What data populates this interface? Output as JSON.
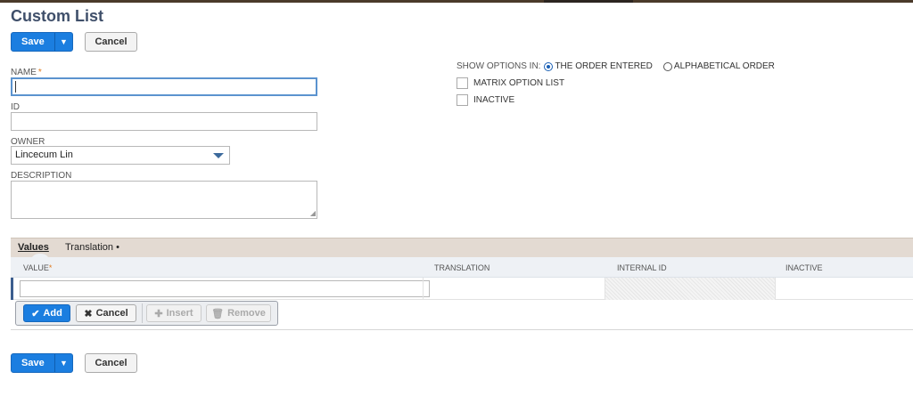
{
  "page": {
    "title": "Custom List"
  },
  "toolbar": {
    "save_label": "Save",
    "dropdown_glyph": "▼",
    "cancel_label": "Cancel"
  },
  "form": {
    "name_label": "NAME",
    "required_mark": "*",
    "name_value": "",
    "id_label": "ID",
    "id_value": "",
    "owner_label": "OWNER",
    "owner_value": "Lincecum Lin",
    "description_label": "DESCRIPTION",
    "description_value": ""
  },
  "options": {
    "show_label": "SHOW OPTIONS IN:",
    "order_entered": "THE ORDER ENTERED",
    "alphabetical": "ALPHABETICAL ORDER",
    "selected": "order_entered",
    "matrix_label": "MATRIX OPTION LIST",
    "matrix_checked": false,
    "inactive_label": "INACTIVE",
    "inactive_checked": false
  },
  "tabs": [
    {
      "label": "Values",
      "active": true
    },
    {
      "label": "Translation •",
      "active": false
    }
  ],
  "grid": {
    "columns": [
      "VALUE",
      "TRANSLATION",
      "INTERNAL ID",
      "INACTIVE"
    ],
    "value_required_mark": "*"
  },
  "row_actions": {
    "add": "Add",
    "cancel": "Cancel",
    "insert": "Insert",
    "remove": "Remove"
  },
  "icons": {
    "add": "check-icon",
    "cancel": "x-icon",
    "insert": "plus-icon",
    "remove": "trash-icon"
  },
  "colors": {
    "primary_button": "#1b7ee0",
    "title": "#3f4f6a",
    "required": "#e07a1d",
    "tab_bar": "#e3dad2"
  }
}
